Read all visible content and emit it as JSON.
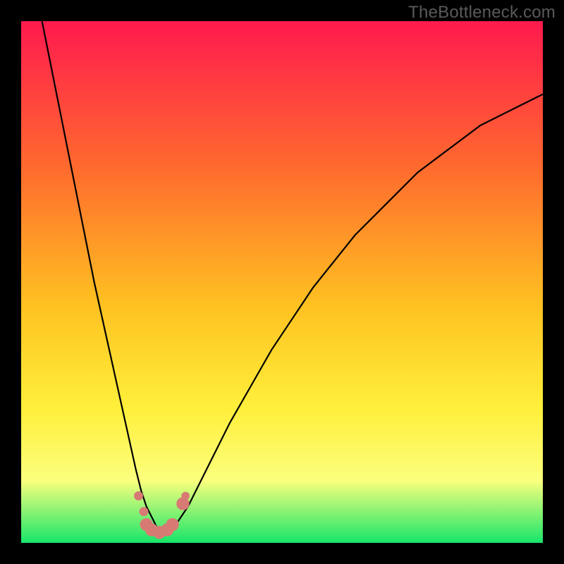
{
  "watermark": "TheBottleneck.com",
  "colors": {
    "frame": "#000000",
    "gradient_top": "#ff1a4e",
    "gradient_mid_upper": "#ff6a2e",
    "gradient_mid": "#ffc321",
    "gradient_mid_lower": "#ffef3a",
    "gradient_lower": "#fbff7d",
    "gradient_bottom": "#17e66a",
    "curve": "#000000",
    "marker": "#d87a74"
  },
  "chart_data": {
    "type": "line",
    "title": "",
    "xlabel": "",
    "ylabel": "",
    "xlim": [
      0,
      100
    ],
    "ylim": [
      0,
      100
    ],
    "grid": false,
    "legend": false,
    "series": [
      {
        "name": "bottleneck-curve",
        "x": [
          4,
          6,
          8,
          10,
          12,
          14,
          16,
          18,
          20,
          22,
          23,
          24,
          25,
          26,
          27,
          28,
          29,
          30,
          32,
          34,
          36,
          38,
          40,
          44,
          48,
          52,
          56,
          60,
          64,
          68,
          72,
          76,
          80,
          84,
          88,
          92,
          96,
          100
        ],
        "y": [
          100,
          90,
          80,
          70,
          60,
          50,
          41,
          32,
          23,
          14,
          10,
          7,
          5,
          3,
          2,
          2,
          3,
          4,
          7,
          11,
          15,
          19,
          23,
          30,
          37,
          43,
          49,
          54,
          59,
          63,
          67,
          71,
          74,
          77,
          80,
          82,
          84,
          86
        ]
      }
    ],
    "markers": [
      {
        "x": 22.5,
        "y": 9.0,
        "r": 0.9
      },
      {
        "x": 23.5,
        "y": 6.0,
        "r": 0.9
      },
      {
        "x": 24.0,
        "y": 3.5,
        "r": 1.3
      },
      {
        "x": 25.0,
        "y": 2.5,
        "r": 1.3
      },
      {
        "x": 26.5,
        "y": 2.0,
        "r": 1.3
      },
      {
        "x": 28.0,
        "y": 2.5,
        "r": 1.3
      },
      {
        "x": 29.0,
        "y": 3.5,
        "r": 1.3
      },
      {
        "x": 31.0,
        "y": 7.5,
        "r": 1.3
      },
      {
        "x": 31.5,
        "y": 9.0,
        "r": 0.8
      }
    ],
    "minimum": {
      "x": 26.5,
      "y": 2.0
    }
  }
}
